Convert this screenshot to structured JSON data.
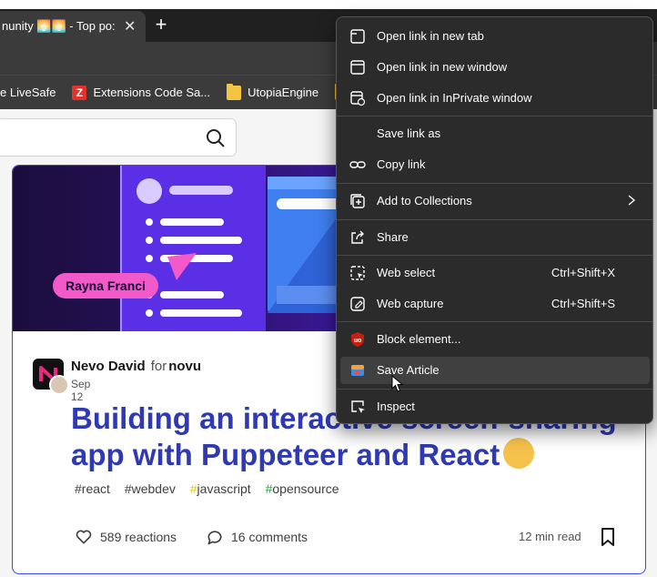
{
  "browser": {
    "tab_title": "nunity 🌅🌅 - Top po:",
    "favorites": [
      {
        "label": "e LiveSafe"
      },
      {
        "label": "Extensions Code Sa..."
      },
      {
        "label": "UtopiaEngine"
      }
    ]
  },
  "article": {
    "cover_name": "Rayna Franci",
    "author": "Nevo David",
    "for_text": "for",
    "org": "novu",
    "date": "Sep 12",
    "title": "Building an interactive screen-sharing app with Puppeteer and React",
    "tags": [
      "#react",
      "#webdev",
      "javascript",
      "opensource"
    ],
    "tag_hash": "#",
    "reactions": "589 reactions",
    "comments": "16 comments",
    "read_time": "12 min read"
  },
  "context_menu": {
    "items": [
      {
        "label": "Open link in new tab",
        "icon": "new-tab-icon"
      },
      {
        "label": "Open link in new window",
        "icon": "new-window-icon"
      },
      {
        "label": "Open link in InPrivate window",
        "icon": "inprivate-icon"
      },
      {
        "label": "Save link as",
        "icon": ""
      },
      {
        "label": "Copy link",
        "icon": "link-icon"
      },
      {
        "label": "Add to Collections",
        "icon": "collections-icon"
      },
      {
        "label": "Share",
        "icon": "share-icon"
      },
      {
        "label": "Web select",
        "icon": "web-select-icon",
        "shortcut": "Ctrl+Shift+X"
      },
      {
        "label": "Web capture",
        "icon": "web-capture-icon",
        "shortcut": "Ctrl+Shift+S"
      },
      {
        "label": "Block element...",
        "icon": "ublock-icon"
      },
      {
        "label": "Save Article",
        "icon": "save-article-icon"
      },
      {
        "label": "Inspect",
        "icon": "inspect-icon"
      }
    ],
    "highlighted_item": "Save Article"
  },
  "colors": {
    "menu_bg": "#2b2b2b",
    "accent": "#3b49df",
    "title": "#2f3ab2"
  }
}
